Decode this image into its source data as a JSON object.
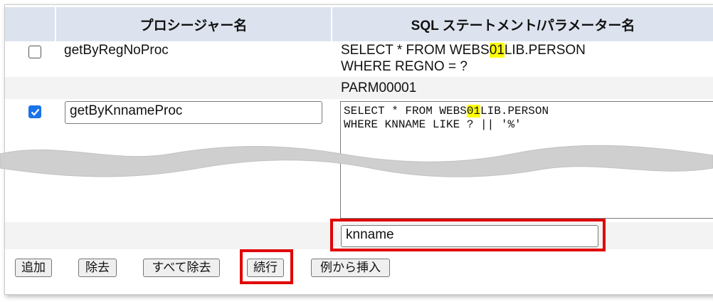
{
  "table": {
    "headers": {
      "procedure_name": "プロシージャー名",
      "sql_statement": "SQL ステートメント/パラメーター名"
    },
    "rows": [
      {
        "checked": false,
        "procedure_name": "getByRegNoProc",
        "sql_line1_pre": "SELECT * FROM WEBS",
        "sql_line1_hl": "01",
        "sql_line1_post": "LIB.PERSON",
        "sql_line2": "WHERE REGNO = ?",
        "parameter": "PARM00001"
      },
      {
        "checked": true,
        "procedure_name": "getByKnnameProc",
        "sql_line1_pre": "SELECT * FROM WEBS",
        "sql_line1_hl": "01",
        "sql_line1_post": "LIB.PERSON",
        "sql_line2": "WHERE KNNAME LIKE ? || '%'",
        "parameter": "knname"
      }
    ]
  },
  "buttons": {
    "add": "追加",
    "remove": "除去",
    "remove_all": "すべて除去",
    "continue": "続行",
    "insert_example": "例から挿入"
  },
  "colors": {
    "header_bg": "#dce3ee",
    "highlight": "#ffff00",
    "annotation_red": "#e00000",
    "checkbox_blue": "#1a73e8"
  }
}
